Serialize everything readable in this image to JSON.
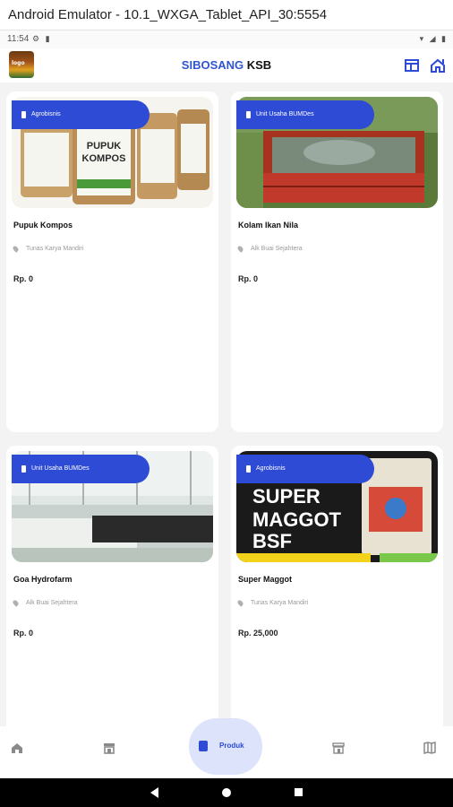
{
  "window": {
    "title": "Android Emulator - 10.1_WXGA_Tablet_API_30:5554"
  },
  "status_bar": {
    "time": "11:54",
    "left_icons": [
      "settings-icon",
      "sd-card-icon"
    ],
    "right_icons": [
      "wifi-icon",
      "signal-icon",
      "battery-icon"
    ]
  },
  "app_bar": {
    "logo_alt": "logo",
    "title_part1": "SIBOSANG",
    "title_part2": "KSB",
    "actions": [
      "dashboard-icon",
      "home-outline-icon"
    ]
  },
  "products": [
    {
      "category": "Agrobisnis",
      "name": "Pupuk Kompos",
      "location": "Tunas Karya Mandiri",
      "price": "Rp. 0"
    },
    {
      "category": "Unit Usaha BUMDes",
      "name": "Kolam Ikan Nila",
      "location": "Alk Buai Sejahtera",
      "price": "Rp. 0"
    },
    {
      "category": "Unit Usaha BUMDes",
      "name": "Goa Hydrofarm",
      "location": "Alk Buai Sejahtera",
      "price": "Rp. 0"
    },
    {
      "category": "Agrobisnis",
      "name": "Super Maggot",
      "location": "Tunas Karya Mandiri",
      "price": "Rp. 25,000"
    }
  ],
  "bottom_nav": {
    "items": [
      "home-icon",
      "store-icon",
      "product-icon",
      "shop-icon",
      "map-icon"
    ],
    "active_label": "Produk"
  },
  "colors": {
    "accent": "#2e4bd6",
    "active_bg": "#dce3fb"
  }
}
